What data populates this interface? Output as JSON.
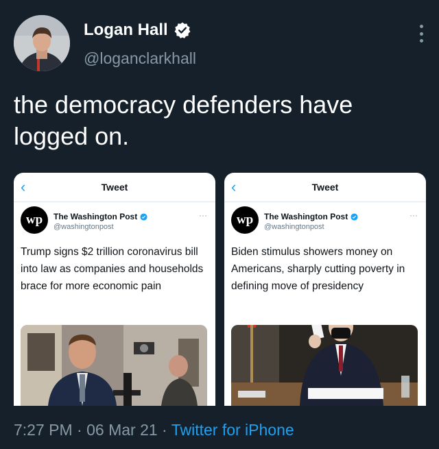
{
  "author": {
    "display_name": "Logan Hall",
    "handle": "@loganclarkhall"
  },
  "tweet_text": "the democracy defenders have logged on.",
  "screenshots": [
    {
      "header": "Tweet",
      "author_name": "The Washington Post",
      "author_handle": "@washingtonpost",
      "logo_text": "wp",
      "headline": "Trump signs $2 trillion coronavirus bill into law as companies and households brace for more economic pain"
    },
    {
      "header": "Tweet",
      "author_name": "The Washington Post",
      "author_handle": "@washingtonpost",
      "logo_text": "wp",
      "headline": "Biden stimulus showers money on Americans, sharply cutting poverty in defining move of presidency"
    }
  ],
  "meta": {
    "time": "7:27 PM",
    "separator": " · ",
    "date": "06 Mar 21",
    "source": "Twitter for iPhone"
  },
  "colors": {
    "background": "#15202b",
    "accent": "#1da1f2",
    "muted": "#8899a6"
  }
}
